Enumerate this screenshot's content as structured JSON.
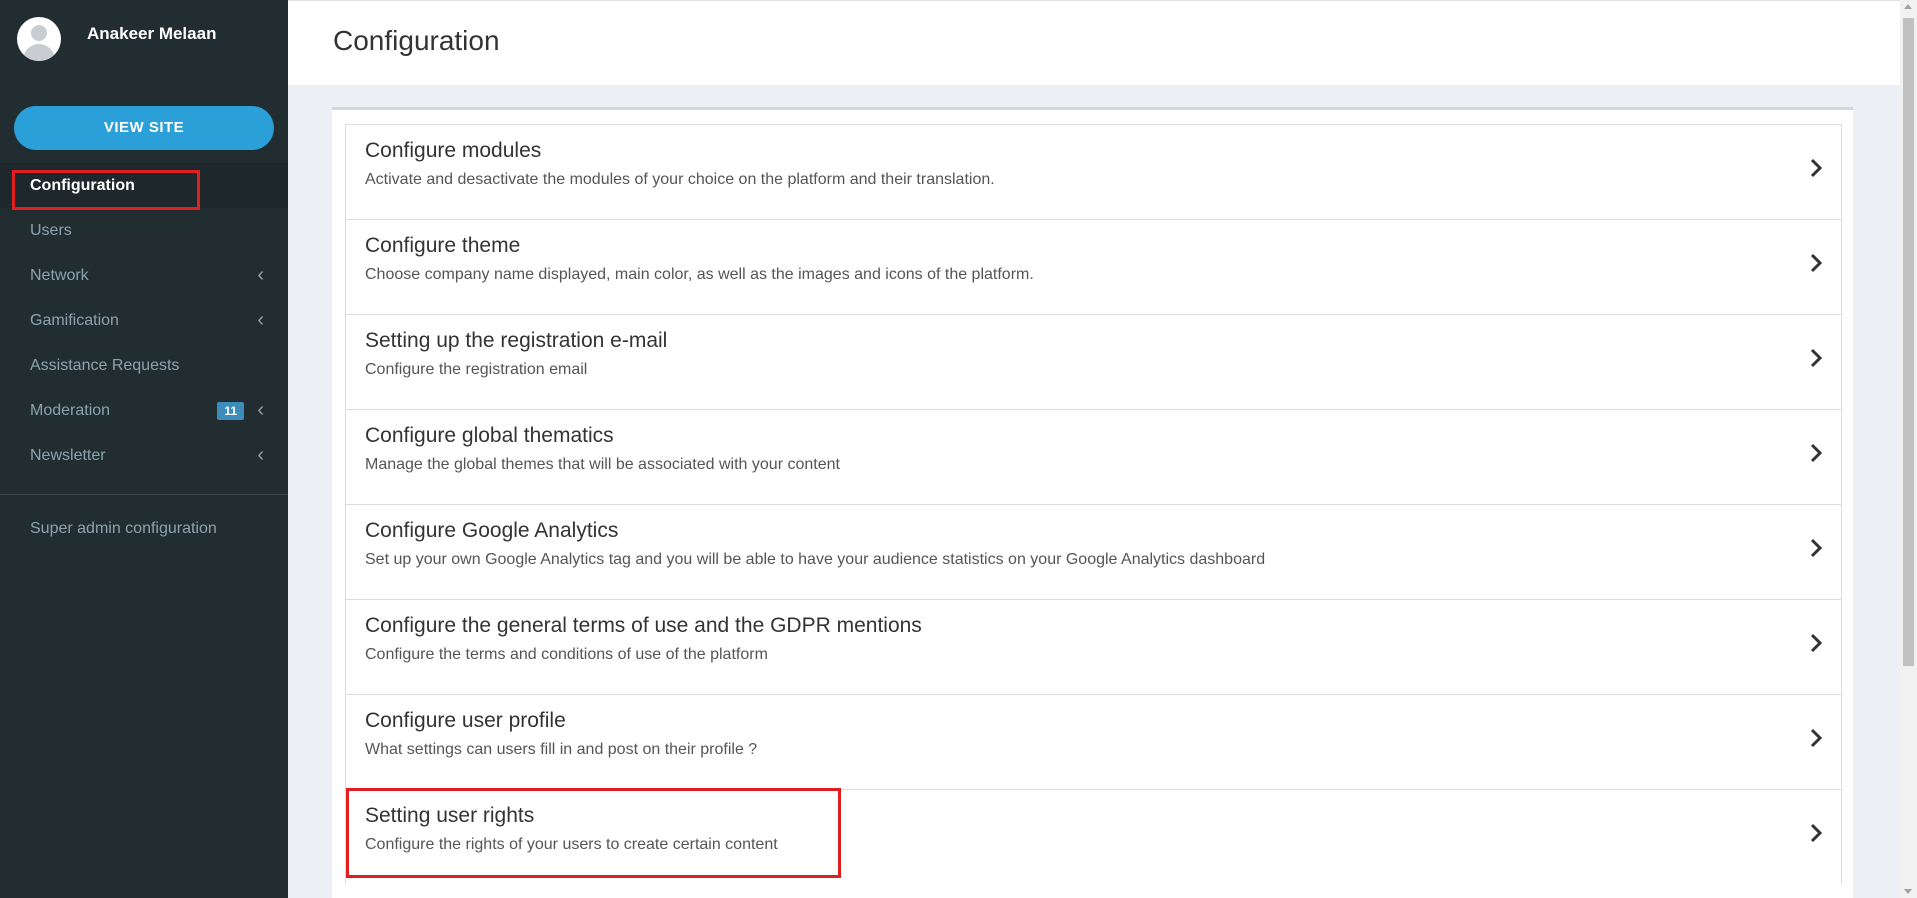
{
  "user": {
    "name": "Anakeer Melaan"
  },
  "sidebar": {
    "view_site_label": "VIEW SITE",
    "items": [
      {
        "label": "Configuration",
        "active": true
      },
      {
        "label": "Users"
      },
      {
        "label": "Network",
        "has_chevron": true
      },
      {
        "label": "Gamification",
        "has_chevron": true
      },
      {
        "label": "Assistance Requests"
      },
      {
        "label": "Moderation",
        "badge": "11",
        "has_chevron": true
      },
      {
        "label": "Newsletter",
        "has_chevron": true
      }
    ],
    "super_admin_label": "Super admin configuration"
  },
  "page": {
    "title": "Configuration"
  },
  "config_items": [
    {
      "title": "Configure modules",
      "description": "Activate and desactivate the modules of your choice on the platform and their translation."
    },
    {
      "title": "Configure theme",
      "description": "Choose company name displayed, main color, as well as the images and icons of the platform."
    },
    {
      "title": "Setting up the registration e-mail",
      "description": "Configure the registration email"
    },
    {
      "title": "Configure global thematics",
      "description": "Manage the global themes that will be associated with your content"
    },
    {
      "title": "Configure Google Analytics",
      "description": "Set up your own Google Analytics tag and you will be able to have your audience statistics on your Google Analytics dashboard"
    },
    {
      "title": "Configure the general terms of use and the GDPR mentions",
      "description": "Configure the terms and conditions of use of the platform"
    },
    {
      "title": "Configure user profile",
      "description": "What settings can users fill in and post on their profile ?"
    },
    {
      "title": "Setting user rights",
      "description": "Configure the rights of your users to create certain content"
    }
  ],
  "colors": {
    "sidebar_bg": "#222d32",
    "accent": "#2a9fd8",
    "highlight": "#e02020",
    "badge": "#3c8dbc"
  },
  "icons": {
    "chevron_left": "chevron-left-icon",
    "chevron_right": "chevron-right-icon",
    "avatar": "user-avatar-icon"
  }
}
